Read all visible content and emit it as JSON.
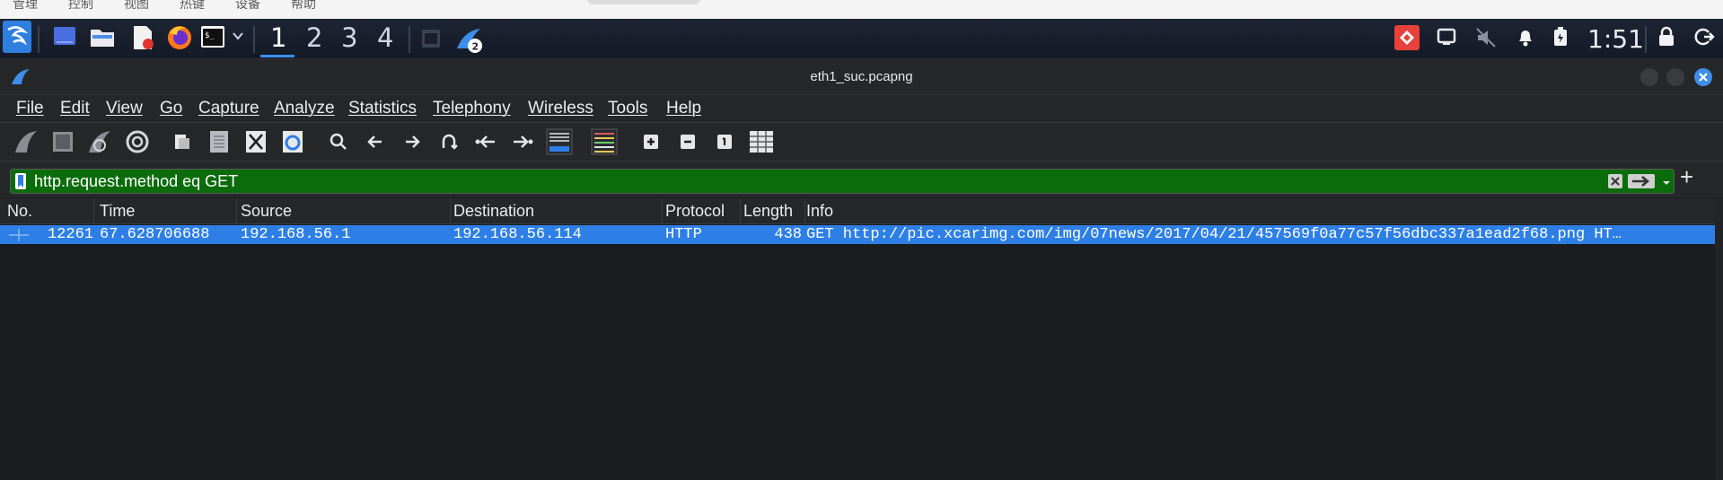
{
  "host_menu": {
    "items": [
      "管理",
      "控制",
      "视图",
      "热键",
      "设备",
      "帮助"
    ]
  },
  "panel": {
    "workspaces": [
      "1",
      "2",
      "3",
      "4"
    ],
    "active_workspace": "1",
    "notification_count": "2",
    "clock": "1:51",
    "icons": [
      "kali-dragon-icon",
      "desktop-icon",
      "file-manager-icon",
      "text-editor-icon",
      "firefox-icon",
      "terminal-icon",
      "chevron-down-icon",
      "terminal-window-icon",
      "wireshark-task-icon",
      "remote-icon",
      "display-icon",
      "mute-icon",
      "bell-icon",
      "battery-icon",
      "lock-icon",
      "logout-icon"
    ]
  },
  "window": {
    "title": "eth1_suc.pcapng"
  },
  "menu": [
    "File",
    "Edit",
    "View",
    "Go",
    "Capture",
    "Analyze",
    "Statistics",
    "Telephony",
    "Wireless",
    "Tools",
    "Help"
  ],
  "filter": {
    "value": "http.request.method eq GET",
    "add_label": "+"
  },
  "columns": [
    "No.",
    "Time",
    "Source",
    "Destination",
    "Protocol",
    "Length",
    "Info"
  ],
  "packets": [
    {
      "no": "12261",
      "time": "67.628706688",
      "source": "192.168.56.1",
      "destination": "192.168.56.114",
      "protocol": "HTTP",
      "length": "438",
      "info": "GET http://pic.xcarimg.com/img/07news/2017/04/21/457569f0a77c57f56dbc337a1ead2f68.png HT…"
    }
  ],
  "colors": {
    "accent": "#3d8ee8",
    "selected_row": "#2d7fe6",
    "filter_ok": "#0b6c0b"
  }
}
